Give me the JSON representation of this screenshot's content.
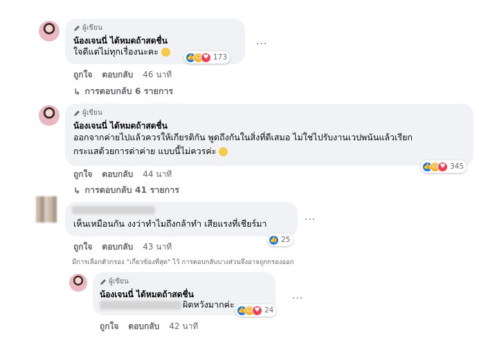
{
  "author_badge": "ผู้เขียน",
  "comments": [
    {
      "name": "น้องเจนนี่ ได้หมดถ้าสดชื่น",
      "lines": [
        "ใจดีแต่ไม่ทุกเรื่องนะคะ"
      ],
      "reaction_count": "173",
      "actions": {
        "like": "ถูกใจ",
        "reply": "ตอบกลับ",
        "time": "46 นาที"
      },
      "replies": "การตอบกลับ 6 รายการ"
    },
    {
      "name": "น้องเจนนี่ ได้หมดถ้าสดชื่น",
      "lines": [
        "ออกจากค่ายไปแล้วควรให้เกียรติกัน พูดถึงกันในสิ่งที่ดีเสมอ ไม่ใช่ไปรับงานเวปพนันแล้วเรียก",
        "กระแสด้วยการด่าค่าย แบบนี้ไม่ควรค่ะ"
      ],
      "reaction_count": "345",
      "actions": {
        "like": "ถูกใจ",
        "reply": "ตอบกลับ",
        "time": "44 นาที"
      },
      "replies": "การตอบกลับ 41 รายการ"
    },
    {
      "lines": [
        "เห็นเหมือนกัน งงว่าทำไมถึงกล้าทำ เสียแรงที่เชียร์มา"
      ],
      "reaction_count": "25",
      "actions": {
        "like": "ถูกใจ",
        "reply": "ตอบกลับ",
        "time": "43 นาที"
      }
    },
    {
      "name": "น้องเจนนี่ ได้หมดถ้าสดชื่น",
      "lines": [
        "ผิดหวังมากค่ะ"
      ],
      "reaction_count": "24",
      "actions": {
        "like": "ถูกใจ",
        "reply": "ตอบกลับ",
        "time": "42 นาที"
      }
    }
  ],
  "filter_notice": "มีการเลือกตัวกรอง \"เกี่ยวข้องที่สุด\" ไว้ การตอบกลับบางส่วนจึงอาจถูกกรองออก",
  "more_dots": "...",
  "colors": {
    "like": "#1877f2",
    "care": "#f7b125",
    "love": "#f33e58",
    "bubble": "#f0f2f5",
    "meta": "#65676b"
  }
}
